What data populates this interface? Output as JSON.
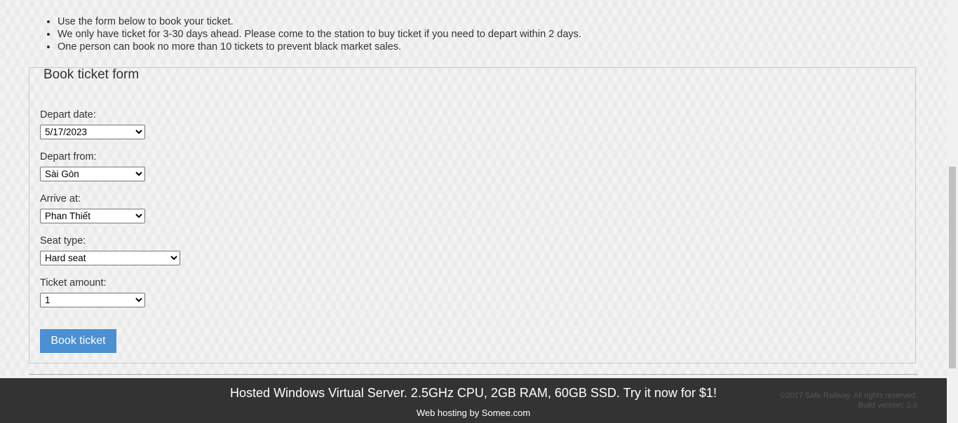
{
  "rules": [
    "Use the form below to book your ticket.",
    "We only have ticket for 3-30 days ahead. Please come to the station to buy ticket if you need to depart within 2 days.",
    "One person can book no more than 10 tickets to prevent black market sales."
  ],
  "form": {
    "legend": "Book ticket form",
    "depart_date": {
      "label": "Depart date:",
      "value": "5/17/2023"
    },
    "depart_from": {
      "label": "Depart from:",
      "value": "Sài Gòn"
    },
    "arrive_at": {
      "label": "Arrive at:",
      "value": "Phan Thiết"
    },
    "seat_type": {
      "label": "Seat type:",
      "value": "Hard seat"
    },
    "ticket_amount": {
      "label": "Ticket amount:",
      "value": "1"
    },
    "submit_label": "Book ticket"
  },
  "footer": {
    "promo": "Hosted Windows Virtual Server. 2.5GHz CPU, 2GB RAM, 60GB SSD. Try it now for $1!",
    "hosting": "Web hosting by Somee.com",
    "copyright": "©2017 Safe Railway. All rights reserved.",
    "build": "Build version: 2.0"
  },
  "colors": {
    "button": "#4a90d2",
    "footer_bg": "#333333"
  }
}
